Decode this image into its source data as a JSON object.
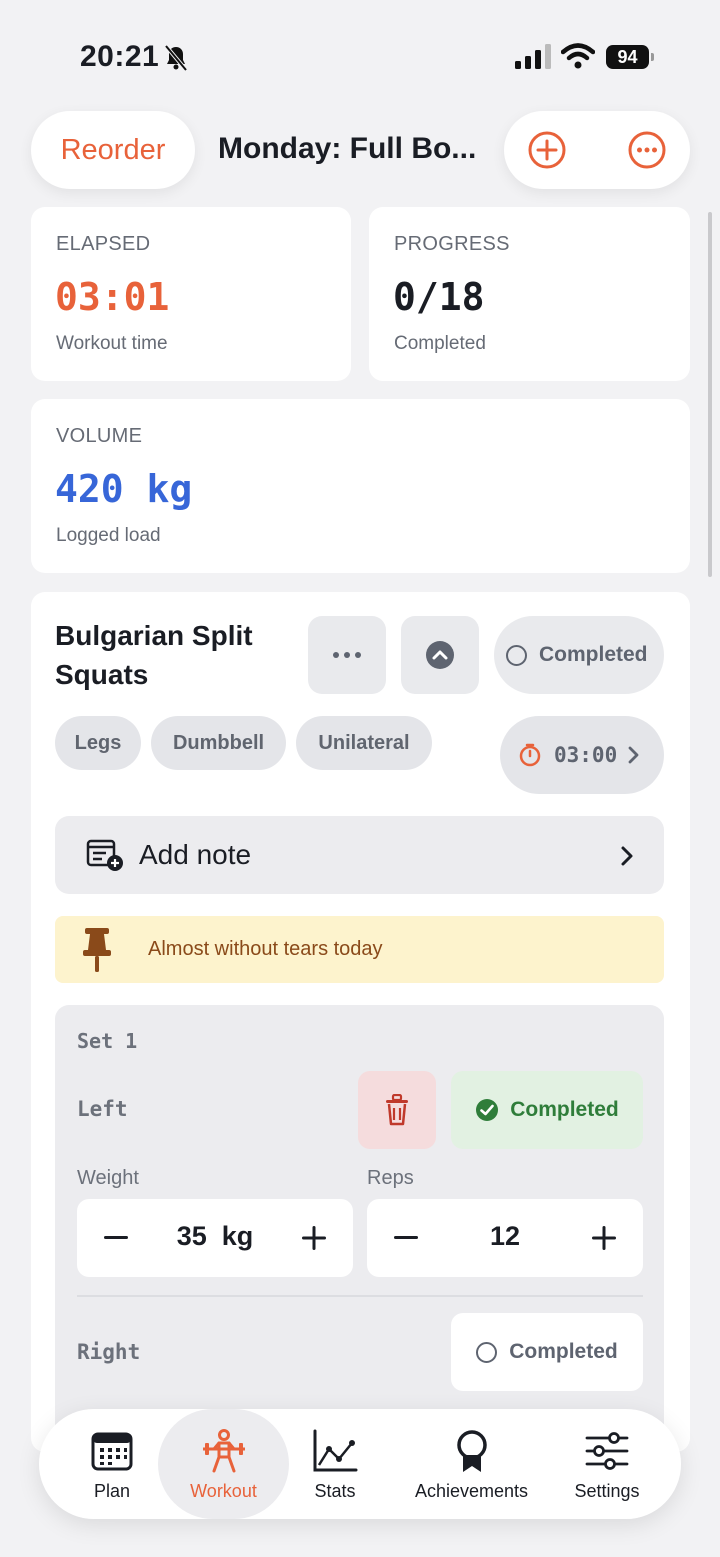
{
  "status_bar": {
    "time": "20:21",
    "battery": "94"
  },
  "header": {
    "reorder_label": "Reorder",
    "title": "Monday: Full Bo...",
    "add_icon": "plus-circle-icon",
    "more_icon": "ellipsis-circle-icon"
  },
  "stats": {
    "elapsed": {
      "label": "ELAPSED",
      "value": "03:01",
      "sub": "Workout time",
      "color": "#e8623a"
    },
    "progress": {
      "label": "PROGRESS",
      "value": "0/18",
      "sub": "Completed",
      "color": "#1a1d24"
    },
    "volume": {
      "label": "VOLUME",
      "value": "420 kg",
      "sub": "Logged load",
      "color": "#3766d8"
    }
  },
  "exercise": {
    "title": "Bulgarian Split Squats",
    "completed_label": "Completed",
    "tags": [
      "Legs",
      "Dumbbell",
      "Unilateral"
    ],
    "rest_timer": "03:00",
    "add_note_label": "Add note",
    "pinned_note": "Almost without tears today",
    "set": {
      "label": "Set 1",
      "left_label": "Left",
      "left_completed_label": "Completed",
      "weight_label": "Weight",
      "reps_label": "Reps",
      "weight_value": "35  kg",
      "reps_value": "12",
      "right_label": "Right",
      "right_completed_label": "Completed"
    }
  },
  "tab_bar": {
    "tabs": [
      {
        "label": "Plan",
        "icon": "calendar-icon"
      },
      {
        "label": "Workout",
        "icon": "weightlifter-icon",
        "active": true
      },
      {
        "label": "Stats",
        "icon": "line-chart-icon"
      },
      {
        "label": "Achievements",
        "icon": "award-icon"
      },
      {
        "label": "Settings",
        "icon": "sliders-icon"
      }
    ]
  },
  "colors": {
    "accent": "#e8623a",
    "volume": "#3766d8",
    "success": "#2f7d3a",
    "danger": "#c0392b"
  }
}
